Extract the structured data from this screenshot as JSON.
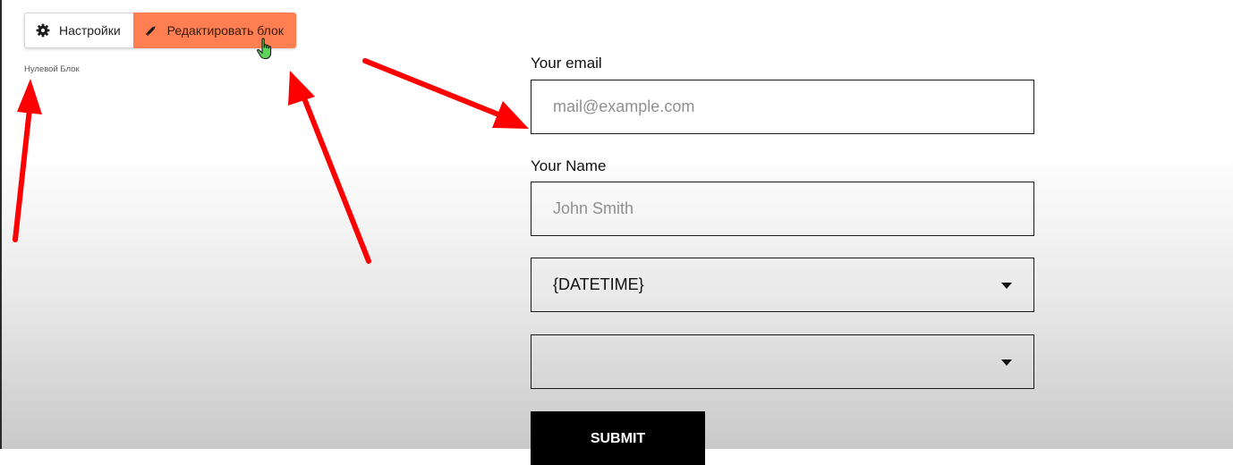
{
  "toolbar": {
    "settings_label": "Настройки",
    "settings_icon": "gear-icon",
    "edit_label": "Редактировать блок",
    "edit_icon": "pencil-icon",
    "edit_color": "#ff7f52"
  },
  "block": {
    "label": "Нулевой Блок"
  },
  "form": {
    "email": {
      "label": "Your email",
      "placeholder": "mail@example.com",
      "value": ""
    },
    "name": {
      "label": "Your Name",
      "placeholder": "John Smith",
      "value": ""
    },
    "select1": {
      "value": "{DATETIME}"
    },
    "select2": {
      "value": ""
    },
    "submit_label": "SUBMIT"
  },
  "annotations": {
    "arrow_color": "#ff0000",
    "arrow_count": 3
  }
}
